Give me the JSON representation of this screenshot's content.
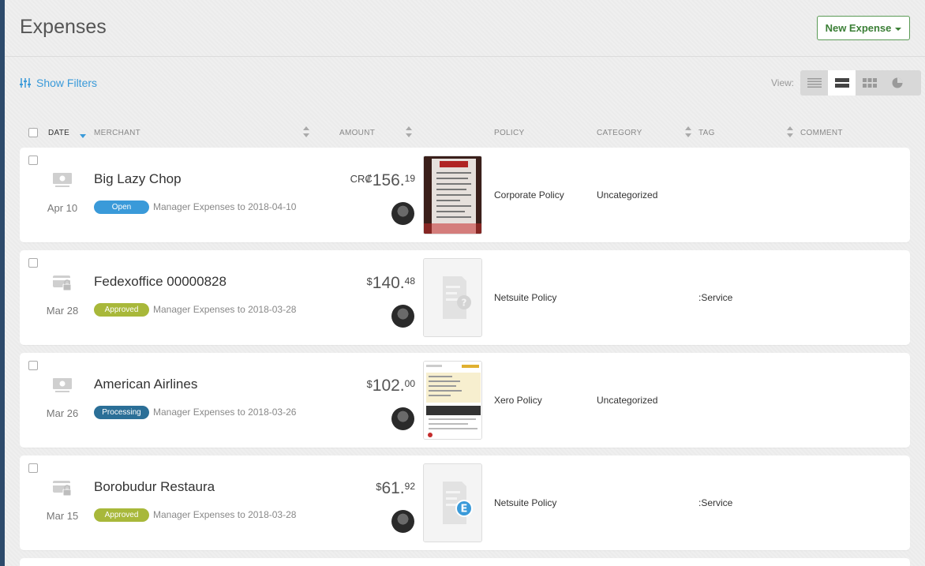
{
  "header": {
    "title": "Expenses",
    "new_expense_label": "New Expense"
  },
  "toolbar": {
    "show_filters_label": "Show Filters",
    "view_label": "View:"
  },
  "columns": {
    "date": "DATE",
    "merchant": "MERCHANT",
    "amount": "AMOUNT",
    "policy": "POLICY",
    "category": "CATEGORY",
    "tag": "TAG",
    "comment": "COMMENT"
  },
  "colors": {
    "open": "#3a9ad9",
    "approved": "#a8b83a",
    "processing": "#2b6f97",
    "accent_green": "#3b7f36"
  },
  "expenses": [
    {
      "merchant": "Big Lazy Chop",
      "date": "Apr 10",
      "status": "Open",
      "report": "Manager Expenses to 2018-04-10",
      "currency": "CR₡",
      "amount_main": "156.",
      "amount_cents": "19",
      "policy": "Corporate Policy",
      "category": "Uncategorized",
      "tag": "",
      "type_icon": "cash-icon",
      "receipt": "receipt-photo"
    },
    {
      "merchant": "Fedexoffice 00000828",
      "date": "Mar 28",
      "status": "Approved",
      "report": "Manager Expenses to 2018-03-28",
      "currency": "$",
      "amount_main": "140.",
      "amount_cents": "48",
      "policy": "Netsuite Policy",
      "category": "",
      "tag": ":Service",
      "type_icon": "card-lock-icon",
      "receipt": "missing-receipt"
    },
    {
      "merchant": "American Airlines",
      "date": "Mar 26",
      "status": "Processing",
      "report": "Manager Expenses to 2018-03-26",
      "currency": "$",
      "amount_main": "102.",
      "amount_cents": "00",
      "policy": "Xero Policy",
      "category": "Uncategorized",
      "tag": "",
      "type_icon": "cash-icon",
      "receipt": "receipt-document"
    },
    {
      "merchant": "Borobudur Restaura",
      "date": "Mar 15",
      "status": "Approved",
      "report": "Manager Expenses to 2018-03-28",
      "currency": "$",
      "amount_main": "61.",
      "amount_cents": "92",
      "policy": "Netsuite Policy",
      "category": "",
      "tag": ":Service",
      "type_icon": "card-lock-icon",
      "receipt": "eReceipt"
    }
  ]
}
